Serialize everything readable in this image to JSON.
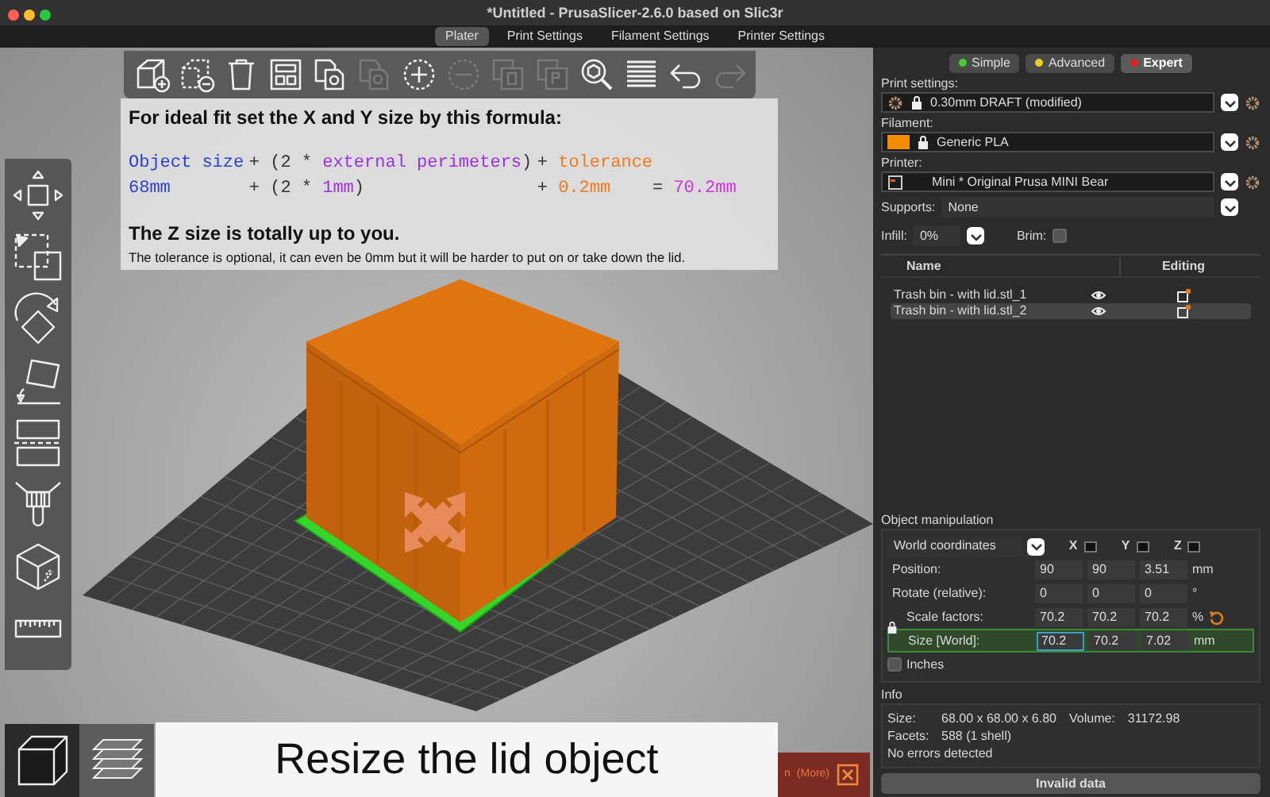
{
  "window": {
    "title": "*Untitled - PrusaSlicer-2.6.0 based on Slic3r"
  },
  "tabs": [
    {
      "label": "Plater",
      "selected": true
    },
    {
      "label": "Print Settings",
      "selected": false
    },
    {
      "label": "Filament Settings",
      "selected": false
    },
    {
      "label": "Printer Settings",
      "selected": false
    }
  ],
  "toolbar": [
    {
      "kind": "add",
      "disabled": false
    },
    {
      "kind": "delete",
      "disabled": false
    },
    {
      "kind": "delete_all",
      "disabled": false
    },
    {
      "kind": "arrange",
      "disabled": false
    },
    {
      "kind": "copy",
      "disabled": false
    },
    {
      "kind": "paste",
      "disabled": true
    },
    {
      "kind": "add_instance",
      "disabled": false
    },
    {
      "kind": "remove_instance",
      "disabled": true
    },
    {
      "kind": "split_objects",
      "disabled": true
    },
    {
      "kind": "split_parts",
      "disabled": true
    },
    {
      "kind": "search",
      "disabled": false
    },
    {
      "kind": "layers",
      "disabled": false
    },
    {
      "kind": "undo",
      "disabled": false
    },
    {
      "kind": "redo",
      "disabled": true
    }
  ],
  "hint": {
    "heading": "For ideal fit set the X and Y size by this formula:",
    "formula_rows": [
      {
        "cells": [
          [
            {
              "text": "Object size",
              "color": "#2a3fd6"
            }
          ],
          [
            {
              "text": "+ (2 *",
              "color": "#333333"
            }
          ],
          [
            {
              "text": "external perimeters",
              "color": "#9b30e0"
            },
            {
              "text": ")",
              "color": "#333333"
            }
          ],
          [
            {
              "text": "+",
              "color": "#333333"
            }
          ],
          [
            {
              "text": "tolerance",
              "color": "#f07a20"
            }
          ]
        ]
      },
      {
        "cells": [
          [
            {
              "text": "68mm",
              "color": "#2a3fd6"
            }
          ],
          [
            {
              "text": "+ (2 *",
              "color": "#333333"
            }
          ],
          [
            {
              "text": "1mm",
              "color": "#9b30e0"
            },
            {
              "text": ")",
              "color": "#333333"
            }
          ],
          [
            {
              "text": "+",
              "color": "#333333"
            }
          ],
          [
            {
              "text": "0.2mm",
              "color": "#f07a20"
            }
          ],
          [
            {
              "text": "=",
              "color": "#333333"
            }
          ],
          [
            {
              "text": "70.2mm",
              "color": "#d030d8"
            }
          ]
        ]
      }
    ],
    "subheading": "The Z size is totally up to you.",
    "note": "The tolerance is optional, it can even be 0mm but it will be harder to put on or take down the lid."
  },
  "side_tools": [
    {
      "kind": "move"
    },
    {
      "kind": "scale"
    },
    {
      "kind": "rotate"
    },
    {
      "kind": "place_on_face"
    },
    {
      "kind": "cut"
    },
    {
      "kind": "paint"
    },
    {
      "kind": "supports"
    },
    {
      "kind": "measure"
    }
  ],
  "view_buttons": [
    {
      "kind": "model",
      "selected": true
    },
    {
      "kind": "preview",
      "selected": false
    }
  ],
  "caption": "Resize the lid object",
  "notification": {
    "text": "n",
    "link": "(More)"
  },
  "modes": [
    {
      "label": "Simple",
      "color": "#44cc33",
      "selected": false
    },
    {
      "label": "Advanced",
      "color": "#e8d020",
      "selected": false
    },
    {
      "label": "Expert",
      "color": "#dd2222",
      "selected": true
    }
  ],
  "print_settings": {
    "label": "Print settings:",
    "value": "0.30mm DRAFT (modified)"
  },
  "filament": {
    "label": "Filament:",
    "value": "Generic PLA",
    "color": "#f28c00"
  },
  "printer": {
    "label": "Printer:",
    "value": "Mini * Original Prusa MINI Bear"
  },
  "supports": {
    "label": "Supports:",
    "value": "None"
  },
  "infill": {
    "label": "Infill:",
    "value": "0%"
  },
  "brim": {
    "label": "Brim:",
    "checked": false
  },
  "object_list": {
    "columns": [
      "Name",
      "Editing"
    ],
    "rows": [
      {
        "name": "Trash bin - with lid.stl_1",
        "selected": false
      },
      {
        "name": "Trash bin - with lid.stl_2",
        "selected": true
      }
    ]
  },
  "manipulation": {
    "title": "Object manipulation",
    "coordinates": "World coordinates",
    "axes": [
      "X",
      "Y",
      "Z"
    ],
    "rows": [
      {
        "label": "Position:",
        "values": [
          {
            "text": "90",
            "focused": false
          },
          {
            "text": "90",
            "focused": false
          },
          {
            "text": "3.51",
            "focused": false
          }
        ],
        "unit": "mm",
        "highlighted": false
      },
      {
        "label": "Rotate (relative):",
        "values": [
          {
            "text": "0",
            "focused": false
          },
          {
            "text": "0",
            "focused": false
          },
          {
            "text": "0",
            "focused": false
          }
        ],
        "unit": "°",
        "highlighted": false
      },
      {
        "label": "Scale factors:",
        "values": [
          {
            "text": "70.2",
            "focused": false
          },
          {
            "text": "70.2",
            "focused": false
          },
          {
            "text": "70.2",
            "focused": false
          }
        ],
        "unit": "%",
        "highlighted": false
      },
      {
        "label": "Size [World]:",
        "values": [
          {
            "text": "70.2",
            "focused": true
          },
          {
            "text": "70.2",
            "focused": false
          },
          {
            "text": "7.02",
            "focused": false
          }
        ],
        "unit": "mm",
        "highlighted": true
      }
    ],
    "inches": {
      "label": "Inches",
      "checked": false
    }
  },
  "info": {
    "title": "Info",
    "size_label": "Size:",
    "size": "68.00 x 68.00 x 6.80",
    "volume_label": "Volume:",
    "volume": "31172.98",
    "facets_label": "Facets:",
    "facets": "588 (1 shell)",
    "status": "No errors detected"
  },
  "action_button": {
    "label": "Invalid data"
  }
}
